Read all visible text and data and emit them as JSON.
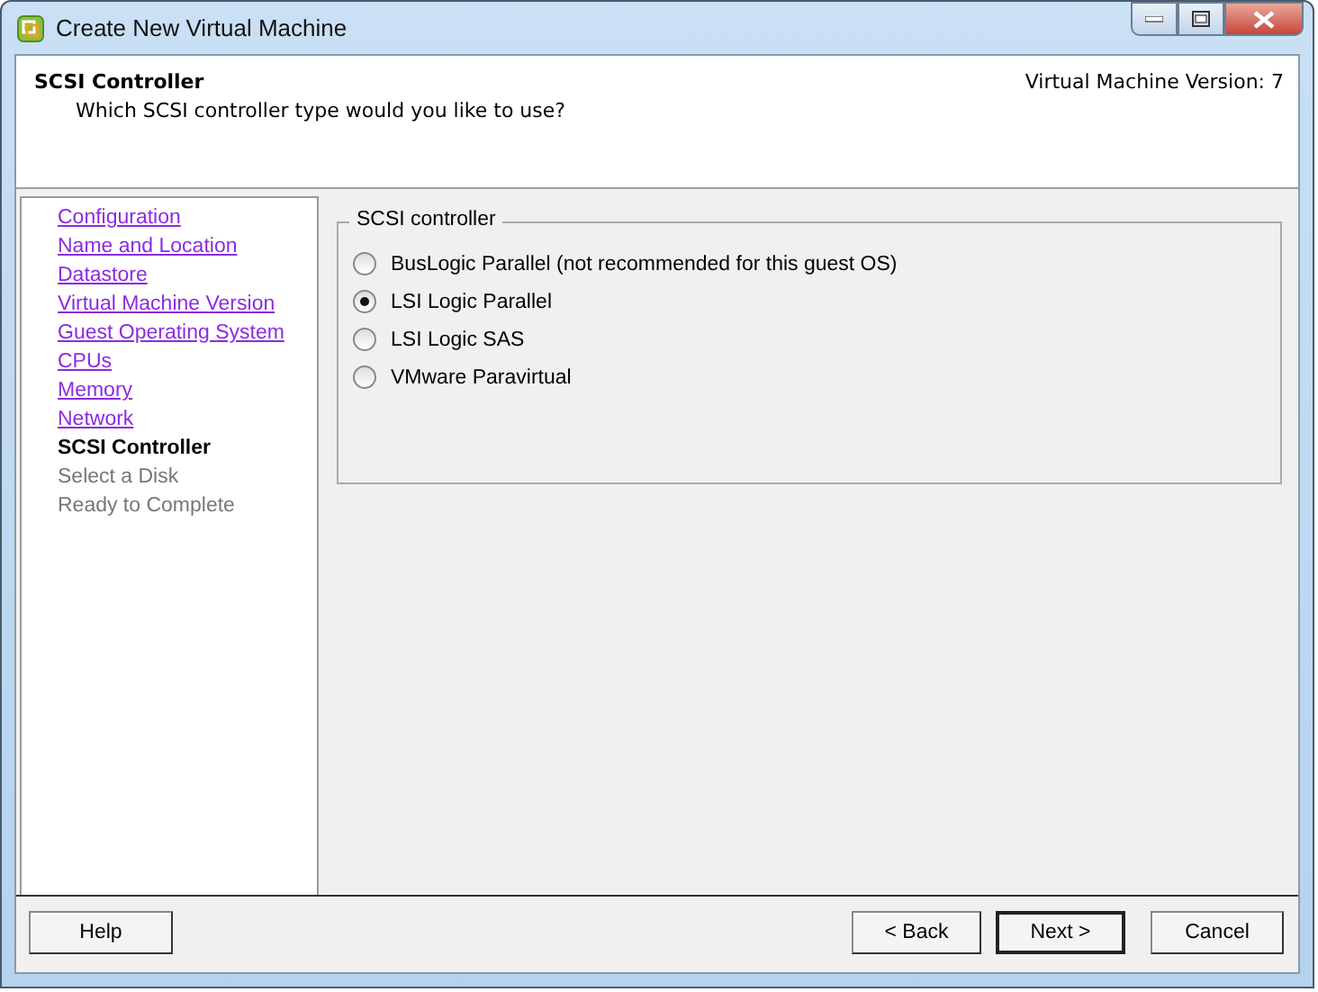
{
  "window": {
    "title": "Create New Virtual Machine"
  },
  "header": {
    "title": "SCSI Controller",
    "subtitle": "Which SCSI controller type would you like to use?",
    "version": "Virtual Machine Version: 7"
  },
  "steps": [
    {
      "label": "Configuration",
      "kind": "done"
    },
    {
      "label": "Name and Location",
      "kind": "done"
    },
    {
      "label": "Datastore",
      "kind": "done"
    },
    {
      "label": "Virtual Machine Version",
      "kind": "done"
    },
    {
      "label": "Guest Operating System",
      "kind": "done"
    },
    {
      "label": "CPUs",
      "kind": "done"
    },
    {
      "label": "Memory",
      "kind": "done"
    },
    {
      "label": "Network",
      "kind": "done"
    },
    {
      "label": "SCSI Controller",
      "kind": "current"
    },
    {
      "label": "Select a Disk",
      "kind": "pending"
    },
    {
      "label": "Ready to Complete",
      "kind": "pending"
    }
  ],
  "group": {
    "legend": "SCSI controller",
    "options": [
      {
        "label": "BusLogic Parallel (not recommended for this guest OS)",
        "selected": false
      },
      {
        "label": "LSI Logic Parallel",
        "selected": true
      },
      {
        "label": "LSI Logic SAS",
        "selected": false
      },
      {
        "label": "VMware Paravirtual",
        "selected": false
      }
    ]
  },
  "buttons": {
    "help": "Help",
    "back": "< Back",
    "next": "Next >",
    "cancel": "Cancel"
  }
}
